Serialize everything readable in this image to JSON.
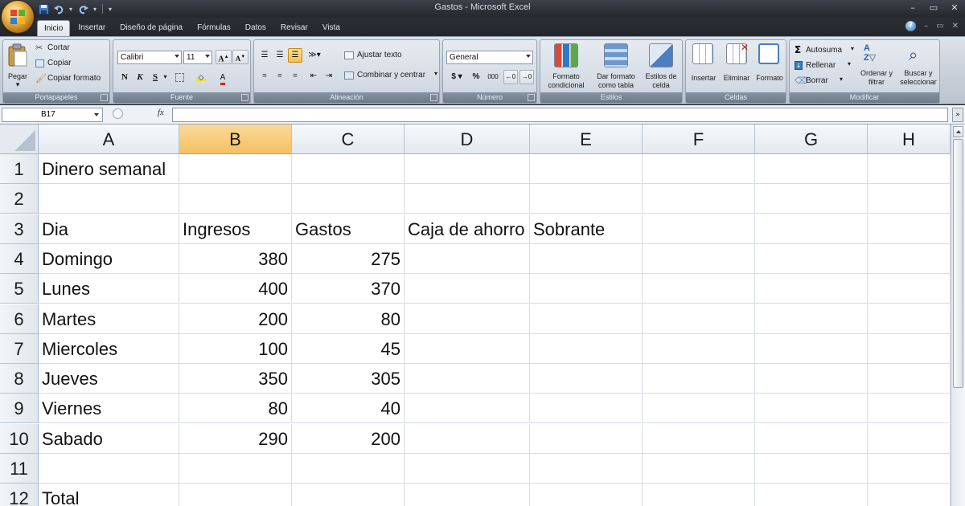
{
  "window": {
    "title": "Gastos - Microsoft Excel",
    "controls": [
      "–",
      "▭",
      "✕"
    ]
  },
  "tabs": [
    "Inicio",
    "Insertar",
    "Diseño de página",
    "Fórmulas",
    "Datos",
    "Revisar",
    "Vista"
  ],
  "ribbon": {
    "clipboard": {
      "label": "Portapapeles",
      "paste": "Pegar",
      "cut": "Cortar",
      "copy": "Copiar",
      "format_painter": "Copiar formato"
    },
    "font": {
      "label": "Fuente",
      "font_name": "Calibri",
      "font_size": "11",
      "bold": "N",
      "italic": "K",
      "underline": "S"
    },
    "alignment": {
      "label": "Alineación",
      "wrap_text": "Ajustar texto",
      "merge_center": "Combinar y centrar"
    },
    "number": {
      "label": "Número",
      "format": "General",
      "currency": "$",
      "percent": "%",
      "thousands": "000"
    },
    "styles": {
      "label": "Estilos",
      "conditional": "Formato condicional",
      "as_table": "Dar formato como tabla",
      "cell_styles": "Estilos de celda"
    },
    "cells": {
      "label": "Celdas",
      "insert": "Insertar",
      "delete": "Eliminar",
      "format": "Formato"
    },
    "editing": {
      "label": "Modificar",
      "autosum": "Autosuma",
      "fill": "Rellenar",
      "clear": "Borrar",
      "sort_filter": "Ordenar y filtrar",
      "find_select": "Buscar y seleccionar"
    }
  },
  "formula_bar": {
    "name_box": "B17",
    "fx": "fx",
    "content": ""
  },
  "sheet": {
    "selected_column": "B",
    "columns": [
      "A",
      "B",
      "C",
      "D",
      "E",
      "F",
      "G",
      "H"
    ],
    "rows": [
      {
        "n": "1",
        "A": "Dinero semanal",
        "B": "",
        "C": "",
        "D": "",
        "E": ""
      },
      {
        "n": "2",
        "A": "",
        "B": "",
        "C": "",
        "D": "",
        "E": ""
      },
      {
        "n": "3",
        "A": "Dia",
        "B": "Ingresos",
        "C": "Gastos",
        "D": "Caja de ahorro",
        "E": "Sobrante"
      },
      {
        "n": "4",
        "A": "Domingo",
        "B": "380",
        "C": "275",
        "D": "",
        "E": ""
      },
      {
        "n": "5",
        "A": "Lunes",
        "B": "400",
        "C": "370",
        "D": "",
        "E": ""
      },
      {
        "n": "6",
        "A": "Martes",
        "B": "200",
        "C": "80",
        "D": "",
        "E": ""
      },
      {
        "n": "7",
        "A": "Miercoles",
        "B": "100",
        "C": "45",
        "D": "",
        "E": ""
      },
      {
        "n": "8",
        "A": "Jueves",
        "B": "350",
        "C": "305",
        "D": "",
        "E": ""
      },
      {
        "n": "9",
        "A": "Viernes",
        "B": "80",
        "C": "40",
        "D": "",
        "E": ""
      },
      {
        "n": "10",
        "A": "Sabado",
        "B": "290",
        "C": "200",
        "D": "",
        "E": ""
      },
      {
        "n": "11",
        "A": "",
        "B": "",
        "C": "",
        "D": "",
        "E": ""
      },
      {
        "n": "12",
        "A": "Total",
        "B": "",
        "C": "",
        "D": "",
        "E": ""
      }
    ]
  }
}
